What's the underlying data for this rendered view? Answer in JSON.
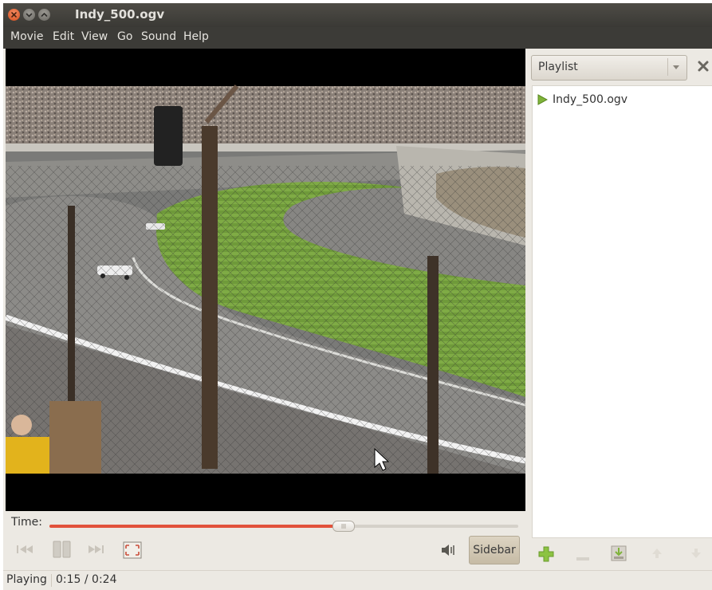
{
  "window": {
    "title": "Indy_500.ogv"
  },
  "menu": [
    "Movie",
    "Edit",
    "View",
    "Go",
    "Sound",
    "Help"
  ],
  "sidebar": {
    "selector_label": "Playlist",
    "playlist": [
      {
        "label": "Indy_500.ogv",
        "icon": "play-icon"
      }
    ]
  },
  "seek": {
    "label": "Time:",
    "position_fraction": 0.625
  },
  "controls": {
    "sidebar_toggle_label": "Sidebar"
  },
  "status": {
    "state": "Playing",
    "time": "0:15 / 0:24"
  },
  "colors": {
    "seek_fill": "#e2523b",
    "playlist_play_icon": "#7fb33a",
    "add_icon": "#8cc342"
  }
}
